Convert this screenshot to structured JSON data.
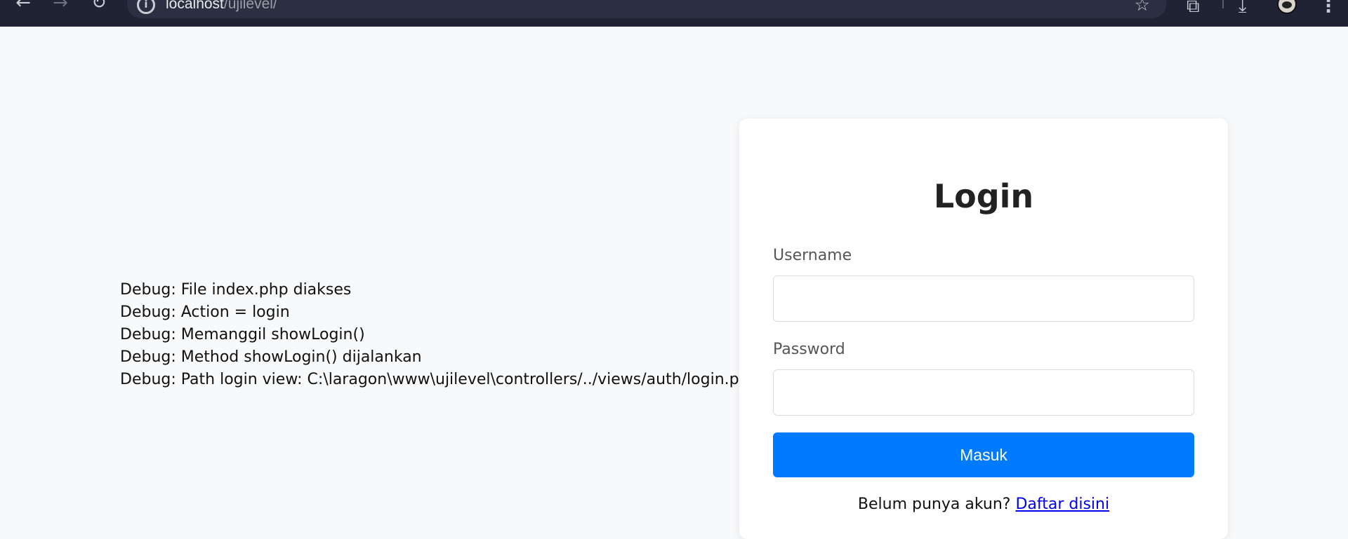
{
  "browser": {
    "url_host": "localhost",
    "url_path": "/ujilevel/",
    "icons": [
      "back-icon",
      "forward-icon",
      "reload-icon",
      "site-info-icon",
      "bookmark-star-icon",
      "extensions-icon",
      "download-icon",
      "profile-avatar",
      "menu-icon"
    ]
  },
  "debug": {
    "lines": [
      "Debug: File index.php diakses",
      "Debug: Action = login",
      "Debug: Memanggil showLogin()",
      "Debug: Method showLogin() dijalankan",
      "Debug: Path login view: C:\\laragon\\www\\ujilevel\\controllers/../views/auth/login.php"
    ]
  },
  "login": {
    "title": "Login",
    "username_label": "Username",
    "username_value": "",
    "password_label": "Password",
    "password_value": "",
    "submit_label": "Masuk",
    "register_prompt": "Belum punya akun?",
    "register_link": "Daftar disini"
  },
  "colors": {
    "primary": "#007bff",
    "page_background": "#f8f9fa",
    "browser_bar": "#1f2333",
    "link": "#0000ee"
  }
}
